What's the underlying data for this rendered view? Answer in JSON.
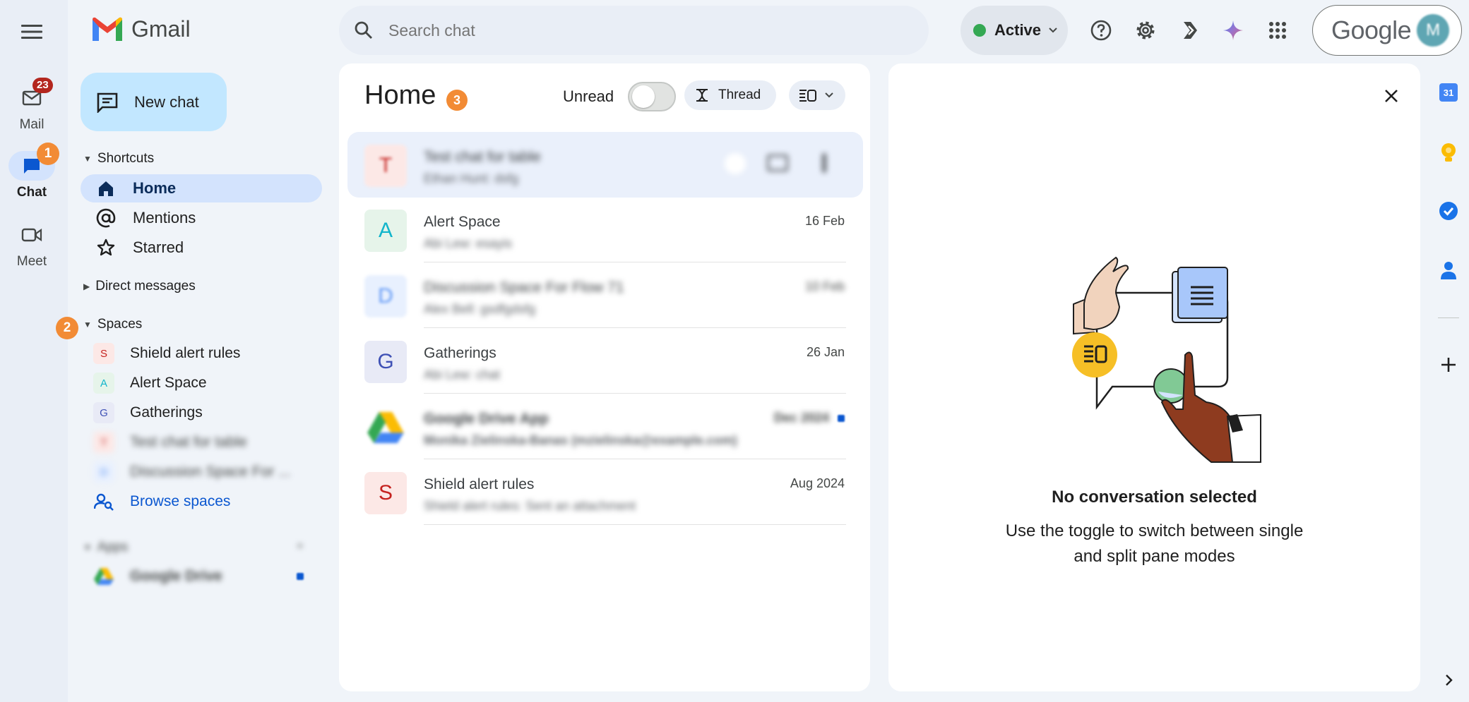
{
  "app": {
    "name": "Gmail",
    "logo_letter": "M"
  },
  "topbar": {
    "search_placeholder": "Search chat",
    "status_label": "Active",
    "status_color": "#34a853",
    "google_label": "Google",
    "avatar_letter": "M",
    "icons": [
      "menu-icon",
      "search-icon",
      "help-icon",
      "settings-icon",
      "extension-icon",
      "gemini-icon",
      "apps-grid-icon"
    ]
  },
  "rail": {
    "mail_label": "Mail",
    "mail_badge": "23",
    "chat_label": "Chat",
    "meet_label": "Meet",
    "marker_1": "1"
  },
  "sidebar": {
    "new_chat_label": "New chat",
    "shortcuts_label": "Shortcuts",
    "shortcuts": [
      {
        "label": "Home",
        "icon": "home-icon",
        "active": true
      },
      {
        "label": "Mentions",
        "icon": "at-icon"
      },
      {
        "label": "Starred",
        "icon": "star-icon"
      }
    ],
    "direct_messages_label": "Direct messages",
    "spaces_label": "Spaces",
    "marker_2": "2",
    "spaces": [
      {
        "letter": "S",
        "label": "Shield alert rules",
        "bg": "#fce8e6",
        "fg": "#c5221f"
      },
      {
        "letter": "A",
        "label": "Alert Space",
        "bg": "#e6f4ea",
        "fg": "#12b5cb"
      },
      {
        "letter": "G",
        "label": "Gatherings",
        "bg": "#e8eaf6",
        "fg": "#3f51b5"
      },
      {
        "letter": "T",
        "label": "Test chat for table",
        "bg": "#fce8e6",
        "fg": "#c5221f",
        "blurred": true
      },
      {
        "letter": "D",
        "label": "Discussion Space For ...",
        "bg": "#e8f0fe",
        "fg": "#5e97f6",
        "blurred": true
      }
    ],
    "browse_spaces_label": "Browse spaces",
    "apps_label": "Apps",
    "apps": [
      {
        "label": "Google Drive",
        "blurred": true
      }
    ]
  },
  "list": {
    "title": "Home",
    "marker_3": "3",
    "unread_label": "Unread",
    "thread_label": "Thread",
    "rows": [
      {
        "letter": "T",
        "title": "Test chat for table",
        "subtitle": "Ethan Hunt: dsfg",
        "date": "",
        "bg": "#fce8e6",
        "fg": "#c5221f",
        "blurred": true,
        "hovered": true
      },
      {
        "letter": "A",
        "title": "Alert Space",
        "subtitle": "Abi Lew: esayis",
        "date": "16 Feb",
        "bg": "#e6f4ea",
        "fg": "#12b5cb",
        "blurred_sub": true
      },
      {
        "letter": "D",
        "title": "Discussion Space For Flow 71",
        "subtitle": "Alex Bell: gsdfgdsfg",
        "date": "10 Feb",
        "bg": "#e8f0fe",
        "fg": "#5e97f6",
        "blurred": true
      },
      {
        "letter": "G",
        "title": "Gatherings",
        "subtitle": "Abi Lew: chat",
        "date": "26 Jan",
        "bg": "#e8eaf6",
        "fg": "#3f51b5",
        "blurred_sub": true
      },
      {
        "letter": "",
        "title": "Google Drive App",
        "subtitle": "Monika Zielinska-Banas (mzielinska@example.com)",
        "date": "Dec 2024",
        "blurred": true,
        "drive": true
      },
      {
        "letter": "S",
        "title": "Shield alert rules",
        "subtitle": "Shield alert rules: Sent an attachment",
        "date": "Aug 2024",
        "bg": "#fce8e6",
        "fg": "#c5221f",
        "blurred_sub": true
      }
    ]
  },
  "detail": {
    "heading": "No conversation selected",
    "body_line1": "Use the toggle to switch between single",
    "body_line2": "and split pane modes"
  },
  "right_rail": {
    "calendar_day": "31"
  }
}
